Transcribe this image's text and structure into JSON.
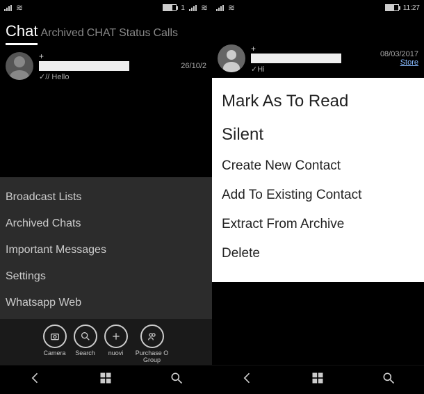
{
  "left": {
    "status": {
      "center": "1"
    },
    "tabs": {
      "active": "Chat",
      "others": [
        "Archived",
        "CHAT",
        "Status",
        "Calls"
      ]
    },
    "chat": {
      "name_placeholder": "+",
      "preview": "✓// Hello",
      "date": "26/10/2"
    },
    "menu": [
      "Broadcast Lists",
      "Archived Chats",
      "Important Messages",
      "Settings",
      "Whatsapp Web"
    ],
    "bottom": [
      {
        "label": "Camera"
      },
      {
        "label": "Search"
      },
      {
        "label": "nuovi"
      },
      {
        "label": "Purchase O Group"
      }
    ]
  },
  "right": {
    "status": {
      "time": "11:27"
    },
    "chat": {
      "name_placeholder": "+",
      "preview": "✓Hi",
      "date": "08/03/2017",
      "store": "Store"
    },
    "context": [
      {
        "text": "Mark As To Read",
        "big": true
      },
      {
        "text": "Silent",
        "big": true
      },
      {
        "text": "Create New Contact",
        "big": false
      },
      {
        "text": "Add To Existing Contact",
        "big": false
      },
      {
        "text": "Extract From Archive",
        "big": false
      },
      {
        "text": "Delete",
        "big": false
      }
    ]
  }
}
